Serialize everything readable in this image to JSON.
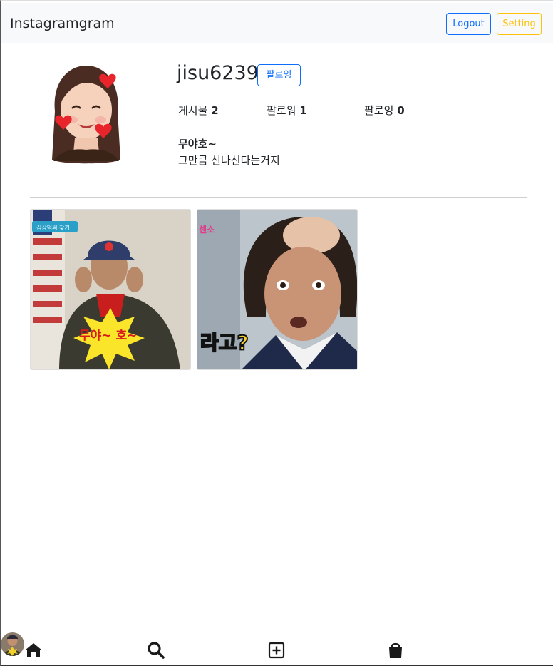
{
  "navbar": {
    "brand": "Instagramgram",
    "logout_label": "Logout",
    "setting_label": "Setting"
  },
  "profile": {
    "username": "jisu6239",
    "follow_label": "팔로잉",
    "stats": {
      "posts_label": "게시물",
      "posts_count": "2",
      "followers_label": "팔로워",
      "followers_count": "1",
      "following_label": "팔로잉",
      "following_count": "0"
    },
    "bio_name": "무야호~",
    "bio_text": "그만큼 신나신다는거지"
  },
  "posts": [
    {
      "caption_overlay": "무야~ 호~",
      "tag": "김상덕씨 찾기"
    },
    {
      "caption_overlay": "라고?",
      "tag": "센소"
    }
  ],
  "bottom_nav": {
    "items": [
      "home-icon",
      "search-icon",
      "add-post-icon",
      "shop-icon",
      "profile-avatar"
    ]
  },
  "colors": {
    "primary": "#0d6efd",
    "warning": "#ffc107",
    "navbar_bg": "#f8f9fa"
  }
}
